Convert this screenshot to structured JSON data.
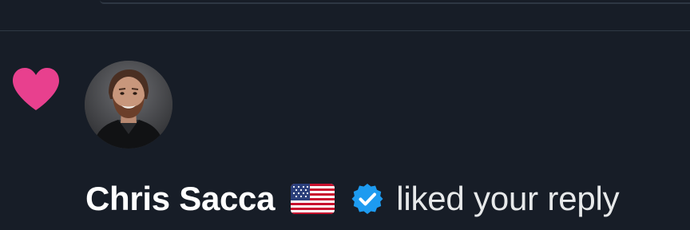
{
  "notification": {
    "type_icon": "heart-icon",
    "user": {
      "name": "Chris Sacca",
      "flag": "flag-us-icon",
      "verified": true,
      "verified_icon": "verified-badge-icon"
    },
    "action": "liked your reply"
  },
  "colors": {
    "background": "#171d27",
    "divider": "#2f3945",
    "heart": "#e8408e",
    "verified": "#1d9bf0",
    "name_text": "#ffffff",
    "action_text": "#e7e9ea"
  }
}
